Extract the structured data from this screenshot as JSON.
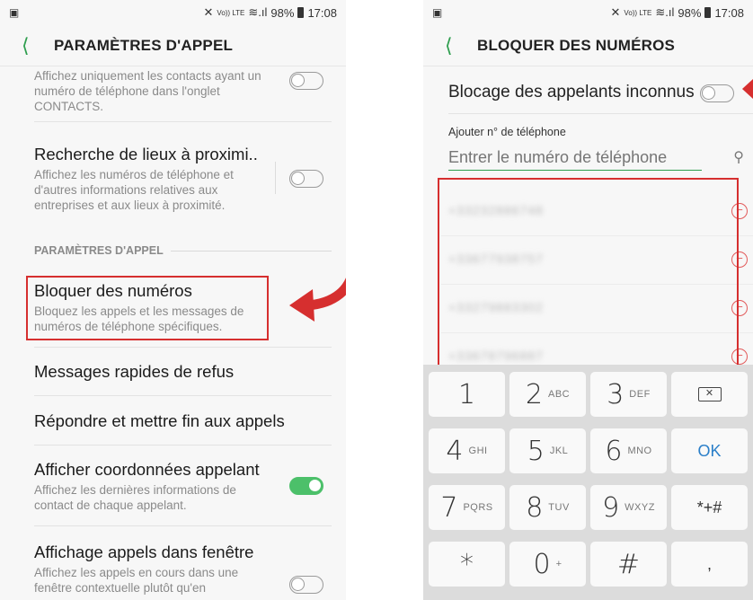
{
  "left": {
    "status": {
      "sim_icon": "sim-icon",
      "signal_text": "Vo)) LTE",
      "battery": "98%",
      "time": "17:08"
    },
    "appbar": {
      "back_icon": "back-chevron-icon",
      "title": "PARAMÈTRES D'APPEL"
    },
    "items": [
      {
        "title": "",
        "desc": "Affichez uniquement les contacts ayant un numéro de téléphone dans l'onglet CONTACTS.",
        "toggle": "off"
      },
      {
        "title": "Recherche de lieux à proximi..",
        "desc": "Affichez les numéros de téléphone et d'autres informations relatives aux entreprises et aux lieux à proximité.",
        "toggle": "off"
      },
      {
        "title": "Bloquer des numéros",
        "desc": "Bloquez les appels et les messages de numéros de téléphone spécifiques."
      },
      {
        "title": "Messages rapides de refus"
      },
      {
        "title": "Répondre et mettre fin aux appels"
      },
      {
        "title": "Afficher coordonnées appelant",
        "desc": "Affichez les dernières informations de contact de chaque appelant.",
        "toggle": "on"
      },
      {
        "title": "Affichage appels dans fenêtre",
        "desc": "Affichez les appels en cours dans une fenêtre contextuelle plutôt qu'en",
        "toggle": "off"
      }
    ],
    "section_header": "PARAMÈTRES D'APPEL"
  },
  "right": {
    "status": {
      "sim_icon": "sim-icon",
      "signal_text": "Vo)) LTE",
      "battery": "98%",
      "time": "17:08"
    },
    "appbar": {
      "back_icon": "back-chevron-icon",
      "title": "BLOQUER DES NUMÉROS"
    },
    "unknown_callers_label": "Blocage des appelants inconnus",
    "add_label": "Ajouter n° de téléphone",
    "input_placeholder": "Entrer le numéro de téléphone",
    "blocked_numbers": [
      "+33232886748",
      "+33677938757",
      "+33279883302",
      "+33678796887"
    ],
    "keypad": {
      "keys": [
        {
          "digit": "1",
          "letters": ""
        },
        {
          "digit": "2",
          "letters": "ABC"
        },
        {
          "digit": "3",
          "letters": "DEF"
        },
        {
          "digit": "",
          "letters": "",
          "icon": "backspace-icon"
        },
        {
          "digit": "4",
          "letters": "GHI"
        },
        {
          "digit": "5",
          "letters": "JKL"
        },
        {
          "digit": "6",
          "letters": "MNO"
        },
        {
          "digit": "OK",
          "letters": ""
        },
        {
          "digit": "7",
          "letters": "PQRS"
        },
        {
          "digit": "8",
          "letters": "TUV"
        },
        {
          "digit": "9",
          "letters": "WXYZ"
        },
        {
          "digit": "*+#",
          "letters": ""
        },
        {
          "digit": "*",
          "letters": ""
        },
        {
          "digit": "0",
          "letters": "+"
        },
        {
          "digit": "#",
          "letters": ""
        },
        {
          "digit": ",",
          "letters": ""
        }
      ]
    }
  },
  "colors": {
    "accent_green": "#2e9e4e",
    "highlight_red": "#d62f2f",
    "ok_blue": "#2b7fc9"
  }
}
